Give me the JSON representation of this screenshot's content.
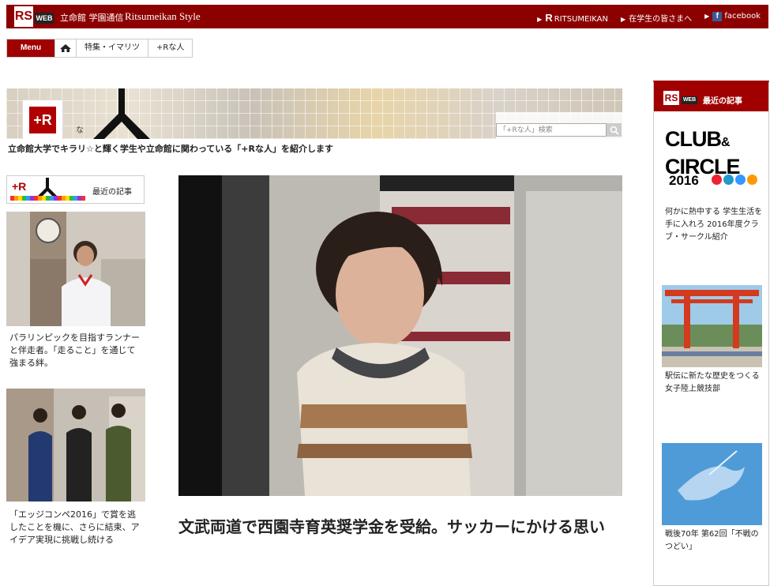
{
  "header": {
    "logo": "RS",
    "logo_sub": "WEB",
    "site_name": "立命館 学園通信",
    "site_sub": "Ritsumeikan Style",
    "links": [
      "RITSUMEIKAN",
      "在学生の皆さまへ",
      "facebook"
    ]
  },
  "nav": {
    "menu": "Menu",
    "items": [
      "特集・イマリツ",
      "+Rな人"
    ]
  },
  "banner": {
    "logo": "+R",
    "na": "な",
    "search_placeholder": "「+Rな人」検索",
    "tagline": "立命館大学でキラリ☆と輝く学生や立命館に関わっている「+Rな人」を紹介します"
  },
  "left": {
    "recent_label": "最近の記事",
    "logo": "+R",
    "articles": [
      {
        "caption": "パラリンピックを目指すランナーと伴走者。「走ること」を通じて強まる絆。"
      },
      {
        "caption": "「エッジコンペ2016」で賞を逃したことを機に、さらに結束、アイデア実現に挑戦し続ける"
      }
    ]
  },
  "main": {
    "headline": "文武両道で西園寺育英奨学金を受給。サッカーにかける思い"
  },
  "right": {
    "header_label": "最近の記事",
    "logo": "RS",
    "logo_sub": "WEB",
    "club_line1": "CLUB",
    "club_amp": "&",
    "club_line2": "CIRCLE",
    "club_year": "2016",
    "articles": [
      {
        "caption": "何かに熱中する 学生生活を 手に入れろ 2016年度クラブ・サークル紹介"
      },
      {
        "caption": "駅伝に新たな歴史をつくる　女子陸上競技部"
      },
      {
        "caption": "戦後70年 第62回「不戦のつどい」"
      }
    ]
  },
  "colors": {
    "brand": "#8c0000",
    "accent": "#a00000"
  }
}
